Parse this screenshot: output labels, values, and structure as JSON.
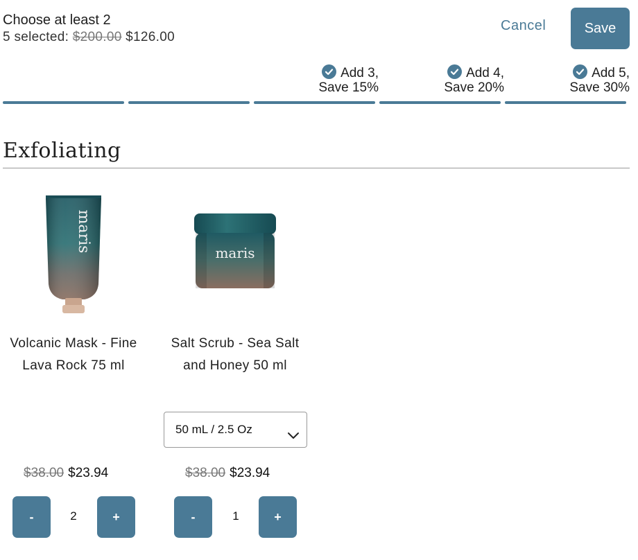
{
  "header": {
    "title": "Choose at least 2",
    "selected_count": "5 selected:",
    "original_total": "$200.00",
    "discounted_total": "$126.00",
    "cancel_label": "Cancel",
    "save_label": "Save"
  },
  "tiers": [
    {
      "line1": "Add 3,",
      "line2": "Save 15%"
    },
    {
      "line1": "Add 4,",
      "line2": "Save 20%"
    },
    {
      "line1": "Add 5,",
      "line2": "Save 30%"
    }
  ],
  "section": {
    "title": "Exfoliating"
  },
  "products": [
    {
      "name": "Volcanic Mask - Fine Lava Rock 75 ml",
      "brand": "maris",
      "original_price": "$38.00",
      "price": "$23.94",
      "quantity": "2",
      "minus": "-",
      "plus": "+"
    },
    {
      "name": "Salt Scrub - Sea Salt and Honey 50 ml",
      "brand": "maris",
      "variant": "50 mL / 2.5 Oz",
      "original_price": "$38.00",
      "price": "$23.94",
      "quantity": "1",
      "minus": "-",
      "plus": "+"
    }
  ],
  "colors": {
    "accent": "#4a7a96"
  },
  "icons": {
    "tier_check": "check-circle-icon",
    "variant_dropdown": "chevron-down-icon"
  }
}
